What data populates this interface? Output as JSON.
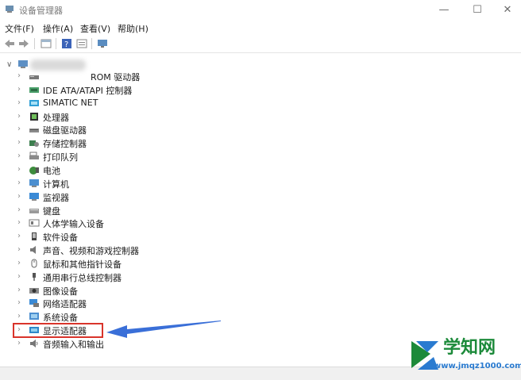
{
  "window": {
    "title": "设备管理器",
    "minimize": "—",
    "maximize": "☐",
    "close": "✕"
  },
  "menu": [
    "文件(F)",
    "操作(A)",
    "查看(V)",
    "帮助(H)"
  ],
  "tree": {
    "items": [
      {
        "label": "ROM 驱动器",
        "icon": "dvd-drive-icon"
      },
      {
        "label": "IDE ATA/ATAPI 控制器",
        "icon": "ide-controller-icon"
      },
      {
        "label": "SIMATIC NET",
        "icon": "simatic-net-icon"
      },
      {
        "label": "处理器",
        "icon": "processor-icon"
      },
      {
        "label": "磁盘驱动器",
        "icon": "disk-drive-icon"
      },
      {
        "label": "存储控制器",
        "icon": "storage-controller-icon"
      },
      {
        "label": "打印队列",
        "icon": "printer-icon"
      },
      {
        "label": "电池",
        "icon": "battery-icon"
      },
      {
        "label": "计算机",
        "icon": "computer-icon"
      },
      {
        "label": "监视器",
        "icon": "monitor-icon"
      },
      {
        "label": "键盘",
        "icon": "keyboard-icon"
      },
      {
        "label": "人体学输入设备",
        "icon": "hid-icon"
      },
      {
        "label": "软件设备",
        "icon": "software-device-icon"
      },
      {
        "label": "声音、视频和游戏控制器",
        "icon": "sound-icon"
      },
      {
        "label": "鼠标和其他指针设备",
        "icon": "mouse-icon"
      },
      {
        "label": "通用串行总线控制器",
        "icon": "usb-icon"
      },
      {
        "label": "图像设备",
        "icon": "camera-icon"
      },
      {
        "label": "网络适配器",
        "icon": "network-adapter-icon"
      },
      {
        "label": "系统设备",
        "icon": "system-device-icon"
      },
      {
        "label": "显示适配器",
        "icon": "display-adapter-icon"
      },
      {
        "label": "音频输入和输出",
        "icon": "audio-io-icon"
      }
    ]
  },
  "watermark": {
    "name": "学知网",
    "url": "www.jmqz1000.com"
  },
  "colors": {
    "highlight": "#d9342b",
    "arrow": "#3a6fd8",
    "watermark_green": "#1c8a3a",
    "watermark_blue": "#2a7bd0"
  }
}
